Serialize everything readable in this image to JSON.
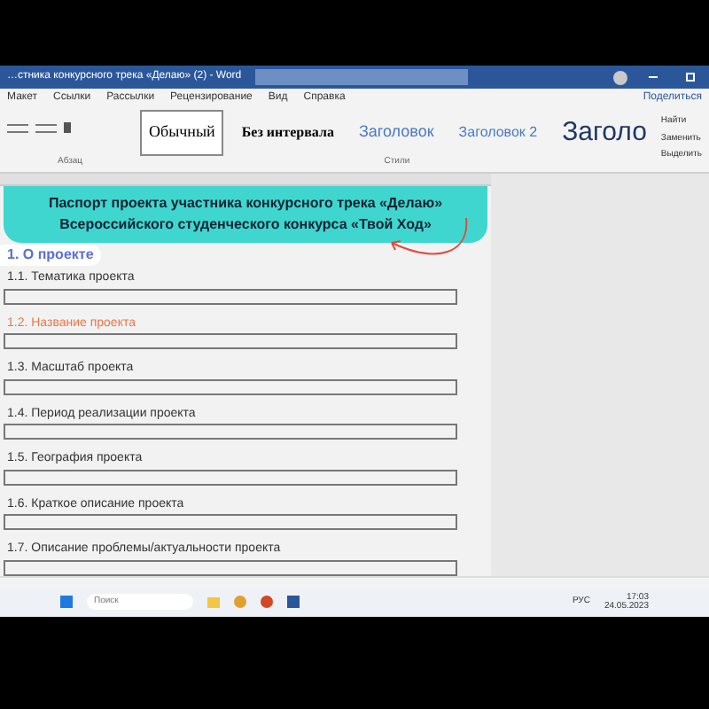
{
  "window": {
    "title": "…стника конкурсного трека «Делаю» (2) - Word"
  },
  "menu": [
    {
      "label": "Макет",
      "selected": false
    },
    {
      "label": "Ссылки",
      "selected": false
    },
    {
      "label": "Рассылки",
      "selected": false
    },
    {
      "label": "Рецензирование",
      "selected": false
    },
    {
      "label": "Вид",
      "selected": false
    },
    {
      "label": "Справка",
      "selected": false
    }
  ],
  "share": "Поделиться",
  "styles": [
    {
      "label": "Обычный",
      "selected": true
    },
    {
      "label": "Без интервала",
      "selected": false
    },
    {
      "label": "Заголовок",
      "selected": false
    },
    {
      "label": "Заголовок 2",
      "selected": false
    },
    {
      "label": "Заголо",
      "selected": false
    }
  ],
  "editing": [
    "Найти",
    "Заменить",
    "Выделить"
  ],
  "group_labels": [
    "Абзац",
    "Стили"
  ],
  "document": {
    "banner": [
      "Паспорт проекта участника конкурсного трека «Делаю»",
      "Всероссийского студенческого конкурса «Твой Ход»"
    ],
    "section": "1. О проекте",
    "fields": [
      {
        "label": "1.1. Тематика проекта",
        "highlighted": false
      },
      {
        "label": "1.2. Название проекта",
        "highlighted": true
      },
      {
        "label": "1.3. Масштаб проекта",
        "highlighted": false
      },
      {
        "label": "1.4. Период реализации проекта",
        "highlighted": false
      },
      {
        "label": "1.5. География проекта",
        "highlighted": false
      },
      {
        "label": "1.6. Краткое описание проекта",
        "highlighted": false
      },
      {
        "label": "1.7. Описание проблемы/актуальности проекта",
        "highlighted": false
      }
    ]
  },
  "taskbar": {
    "search_placeholder": "Поиск",
    "language": "РУС",
    "time": "17:03",
    "date": "24.05.2023"
  }
}
